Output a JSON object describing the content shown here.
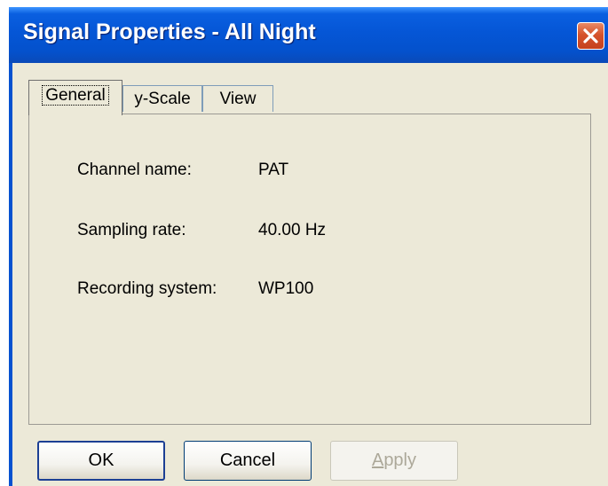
{
  "window": {
    "title": "Signal Properties - All Night",
    "close_icon": "close-icon"
  },
  "tabs": [
    {
      "label": "General",
      "active": true
    },
    {
      "label": "y-Scale",
      "active": false
    },
    {
      "label": "View",
      "active": false
    }
  ],
  "general": {
    "channel_name": {
      "label": "Channel name:",
      "value": "PAT"
    },
    "sampling_rate": {
      "label": "Sampling rate:",
      "value": "40.00 Hz"
    },
    "recording_system": {
      "label": "Recording system:",
      "value": "WP100"
    }
  },
  "buttons": {
    "ok": "OK",
    "cancel": "Cancel",
    "apply_mnemonic": "A",
    "apply_rest": "pply"
  },
  "colors": {
    "titlebar": "#0556d6",
    "close_button": "#d6532c",
    "dialog_face": "#ece9d8",
    "disabled_text": "#aca899"
  }
}
